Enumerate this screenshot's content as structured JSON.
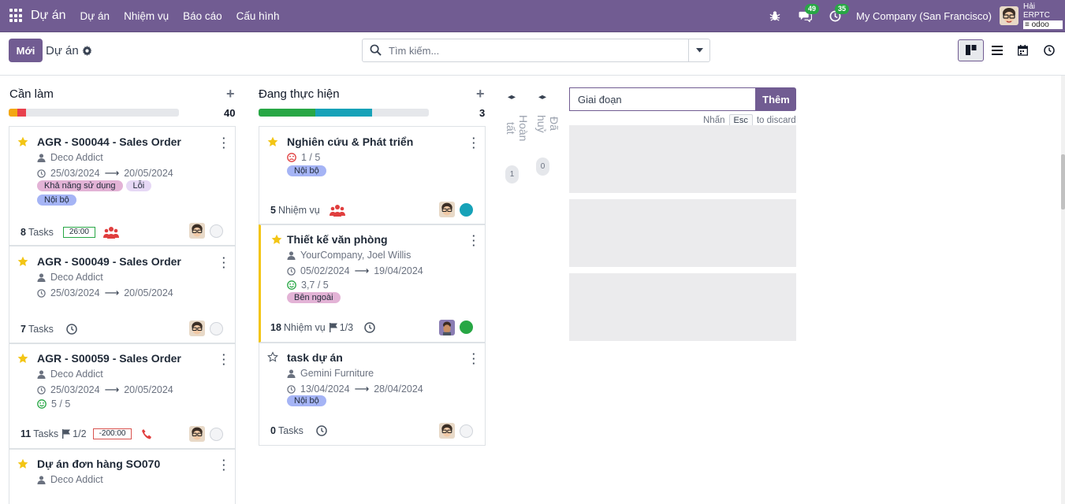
{
  "navbar": {
    "brand": "Dự án",
    "menus": [
      "Dự án",
      "Nhiệm vụ",
      "Báo cáo",
      "Cấu hình"
    ],
    "chat_count": "49",
    "activity_count": "35",
    "company": "My Company (San Francisco)",
    "user_name": "Hải ERPTC",
    "user_db": "odoo"
  },
  "control": {
    "new_label": "Mới",
    "breadcrumb": "Dự án",
    "search_placeholder": "Tìm kiếm..."
  },
  "columns": [
    {
      "title": "Cần làm",
      "count": "40",
      "progress": [
        {
          "color": "#f3a712",
          "frac": 0.05
        },
        {
          "color": "#e8414d",
          "frac": 0.05
        }
      ]
    },
    {
      "title": "Đang thực hiện",
      "count": "3",
      "progress": [
        {
          "color": "#28a745",
          "frac": 0.333
        },
        {
          "color": "#17a2b8",
          "frac": 0.333
        }
      ]
    }
  ],
  "folded": [
    {
      "label": "Hoàn tất",
      "count": "1"
    },
    {
      "label": "Đã huỷ",
      "count": "0"
    }
  ],
  "cards_todo": [
    {
      "title": "AGR - S00044 - Sales Order",
      "partner": "Deco Addict",
      "date_start": "25/03/2024",
      "date_end": "20/05/2024",
      "tags": [
        "Khả năng sử dụng",
        "Lỗi",
        "Nội bộ"
      ],
      "tasks_count": "8",
      "tasks_label": "Tasks",
      "time": "26:00"
    },
    {
      "title": "AGR - S00049 - Sales Order",
      "partner": "Deco Addict",
      "date_start": "25/03/2024",
      "date_end": "20/05/2024",
      "tasks_count": "7",
      "tasks_label": "Tasks"
    },
    {
      "title": "AGR - S00059 - Sales Order",
      "partner": "Deco Addict",
      "date_start": "25/03/2024",
      "date_end": "20/05/2024",
      "rating": "5 / 5",
      "tasks_count": "11",
      "tasks_label": "Tasks",
      "milestone": "1/2",
      "time": "-200:00"
    },
    {
      "title": "Dự án đơn hàng SO070",
      "partner": "Deco Addict"
    }
  ],
  "cards_progress": [
    {
      "title": "Nghiên cứu & Phát triển",
      "rating": "1 / 5",
      "tags": [
        "Nội bộ"
      ],
      "tasks_count": "5",
      "tasks_label": "Nhiệm vụ"
    },
    {
      "title": "Thiết kế văn phòng",
      "partner": "YourCompany, Joel Willis",
      "date_start": "05/02/2024",
      "date_end": "19/04/2024",
      "rating": "3,7 / 5",
      "tags": [
        "Bên ngoài"
      ],
      "tasks_count": "18",
      "tasks_label": "Nhiệm vụ",
      "milestone": "1/3"
    },
    {
      "title": "task dự án",
      "partner": "Gemini Furniture",
      "date_start": "13/04/2024",
      "date_end": "28/04/2024",
      "tags": [
        "Nội bộ"
      ],
      "tasks_count": "0",
      "tasks_label": "Tasks"
    }
  ],
  "quick_stage": {
    "value": "Giai đoạn",
    "button": "Thêm",
    "hint_prefix": "Nhấn",
    "hint_key": "Esc",
    "hint_suffix": "to discard"
  },
  "colors": {
    "brand": "#715c92",
    "tag_pink": "#e3b3d6",
    "tag_lavender": "#e6d8f5",
    "tag_blue": "#a5b4f5",
    "star": "#f3c515"
  }
}
